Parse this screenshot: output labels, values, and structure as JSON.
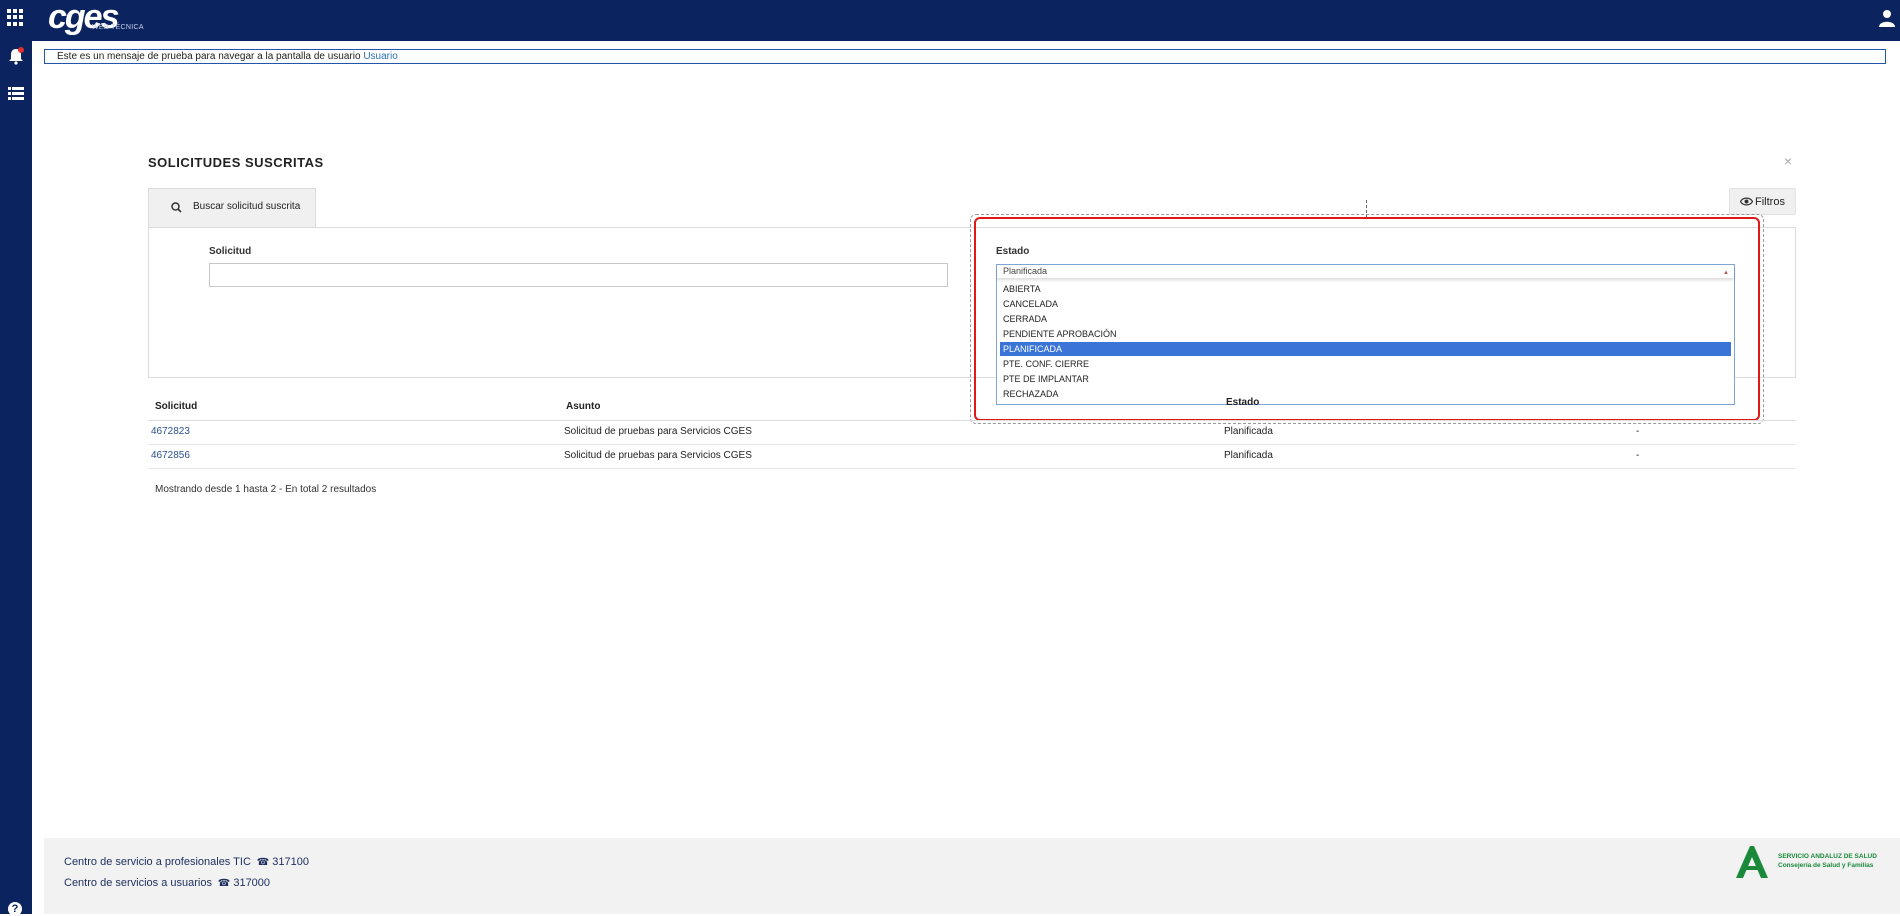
{
  "header": {
    "brand": "cges",
    "brand_sub": "WEB TÉCNICA"
  },
  "notice": {
    "text": "Este es un mensaje de prueba para navegar a la pantalla de usuario",
    "link": "Usuario"
  },
  "section": {
    "title": "SOLICITUDES SUSCRITAS",
    "close": "×"
  },
  "tab": {
    "label": "Buscar solicitud suscrita"
  },
  "filters_button": {
    "label": "Filtros"
  },
  "filter": {
    "solicitud_label": "Solicitud",
    "solicitud_value": "",
    "estado_label": "Estado",
    "estado_value": "Planificada",
    "estado_options": [
      "ABIERTA",
      "CANCELADA",
      "CERRADA",
      "PENDIENTE APROBACIÓN",
      "PLANIFICADA",
      "PTE. CONF. CIERRE",
      "PTE DE IMPLANTAR",
      "RECHAZADA"
    ],
    "selected_index": 4
  },
  "table": {
    "headers": [
      "Solicitud",
      "Asunto",
      "Estado"
    ],
    "rows": [
      {
        "id": "4672823",
        "asunto": "Solicitud de pruebas para Servicios CGES",
        "estado": "Planificada",
        "extra": "-"
      },
      {
        "id": "4672856",
        "asunto": "Solicitud de pruebas para Servicios CGES",
        "estado": "Planificada",
        "extra": "-"
      }
    ]
  },
  "results_text": "Mostrando desde 1 hasta 2 - En total 2 resultados",
  "footer": {
    "line1": "Centro de servicio a profesionales TIC",
    "phone1": "317100",
    "line2": "Centro de servicios a usuarios",
    "phone2": "317000",
    "org1": "SERVICIO ANDALUZ DE SALUD",
    "org2": "Consejería de Salud y Familias",
    "help": "?"
  },
  "colors": {
    "navy": "#0b2460",
    "highlight": "#e01818",
    "selected_option": "#3a74d6"
  }
}
